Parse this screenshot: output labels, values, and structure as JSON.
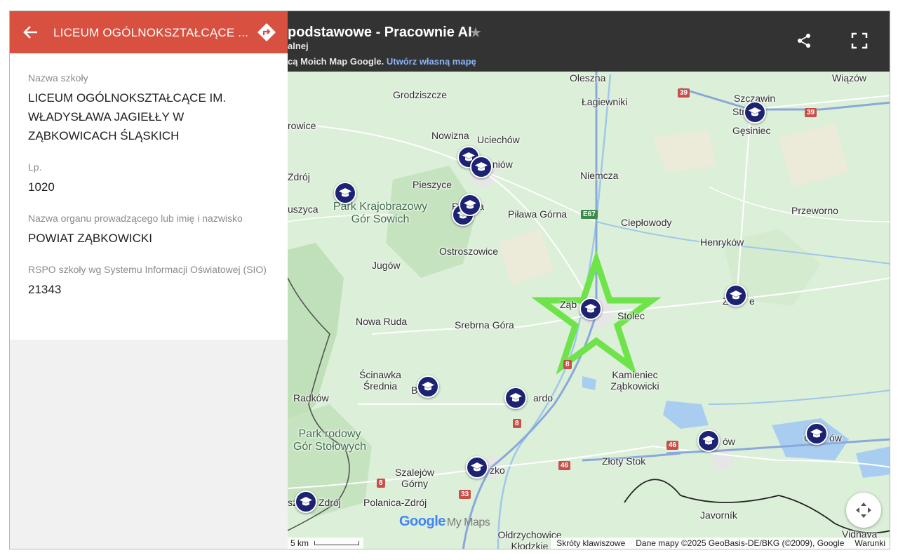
{
  "panel": {
    "title": "LICEUM OGÓLNOKSZTAŁCĄCE ...",
    "fields": [
      {
        "label": "Nazwa szkoły",
        "value": "LICEUM OGÓLNOKSZTAŁCĄCE IM. WŁADYSŁAWA JAGIEŁŁY W ZĄBKOWICACH ŚLĄSKICH"
      },
      {
        "label": "Lp.",
        "value": "1020"
      },
      {
        "label": "Nazwa organu prowadzącego lub imię i nazwisko",
        "value": "POWIAT ZĄBKOWICKI"
      },
      {
        "label": "RSPO szkoły wg Systemu Informacji Oświatowej (SIO)",
        "value": "21343"
      }
    ]
  },
  "map_header": {
    "title": "podstawowe - Pracownie AI",
    "subtitle": "alnej",
    "notice_text": "cą Moich Map Google.",
    "notice_link": "Utwórz własną mapę"
  },
  "places": [
    "Oleszna",
    "Wiązów",
    "Grodziszcze",
    "Łagiewniki",
    "Szczawin",
    "Str",
    "Gęsiniec",
    "rowice",
    "Nowizna",
    "Uciechów",
    "D",
    "niów",
    "Zdrój",
    "Pieszyce",
    "Niemcza",
    "uszyca",
    "P",
    "wa",
    "Piława Górna",
    "Przeworno",
    "Ciepłowody",
    "Henryków",
    "Ostroszowice",
    "Jugów",
    "Zi",
    "e",
    "Ząb",
    "Stolec",
    "Nowa Ruda",
    "Srebrna Góra",
    "Kamieniec Ząbkowicki",
    "Ścinawka Średnia",
    "B",
    "Radków",
    "ardo",
    "Pa",
    "ów",
    "Ot",
    "ów",
    "Złoty Stok",
    "Szalejów Górny",
    "zko",
    "sz",
    "Zdrój",
    "Polanica-Zdrój",
    "Javorník",
    "Vidnava",
    "Ołdrzychowice Kłodzkie"
  ],
  "parks": [
    "Park Krajobrazowy Gór Sowich",
    "Park rodowy Gór Stołowych"
  ],
  "roads": [
    "39",
    "39",
    "E67",
    "8",
    "8",
    "46",
    "46",
    "8",
    "33"
  ],
  "icons": {
    "back": "arrow-left-icon",
    "directions": "directions-icon",
    "share": "share-icon",
    "fullscreen": "fullscreen-icon",
    "recenter": "recenter-icon",
    "pin": "graduation-cap-icon",
    "highlight": "star-outline-icon",
    "favorite": "star-icon"
  },
  "attribution": {
    "scale_label": "5 km",
    "shortcuts": "Skróty klawiszowe",
    "map_data": "Dane mapy ©2025 GeoBasis-DE/BKG (©2009), Google",
    "terms": "Warunki"
  },
  "logo": {
    "google": "Google",
    "mymaps": "My Maps"
  },
  "colors": {
    "panel_header": "#d8503f",
    "topbar": "#333333",
    "pin": "#1c2372",
    "star": "#6ee44a",
    "link": "#8ab4f8"
  }
}
